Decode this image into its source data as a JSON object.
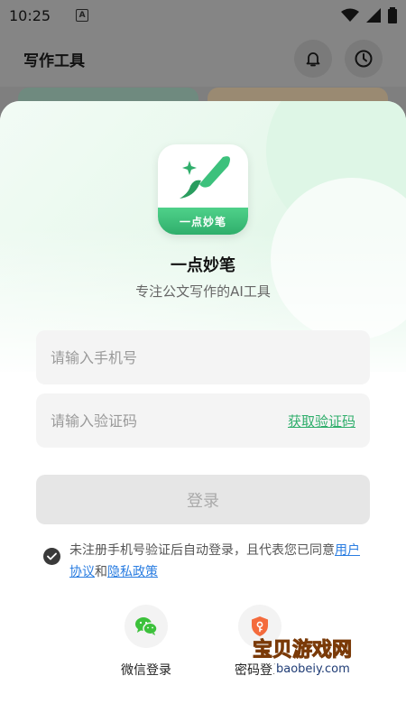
{
  "status_bar": {
    "time": "10:25",
    "a_badge": "A"
  },
  "header": {
    "title": "写作工具"
  },
  "login": {
    "logo_band_text": "一点妙笔",
    "app_name": "一点妙笔",
    "slogan": "专注公文写作的AI工具",
    "phone_placeholder": "请输入手机号",
    "code_placeholder": "请输入验证码",
    "get_code_label": "获取验证码",
    "login_label": "登录",
    "agreement": {
      "prefix": "未注册手机号验证后自动登录，且代表您已同意",
      "user_agreement": "用户协议",
      "and": "和",
      "privacy_policy": "隐私政策"
    },
    "alt_methods": {
      "wechat_label": "微信登录",
      "password_label": "密码登录"
    }
  },
  "watermark": {
    "text": "宝贝游戏网",
    "url": "baobeiy.com"
  },
  "colors": {
    "brand_green": "#2fae6b",
    "link_blue": "#2a7de1"
  }
}
